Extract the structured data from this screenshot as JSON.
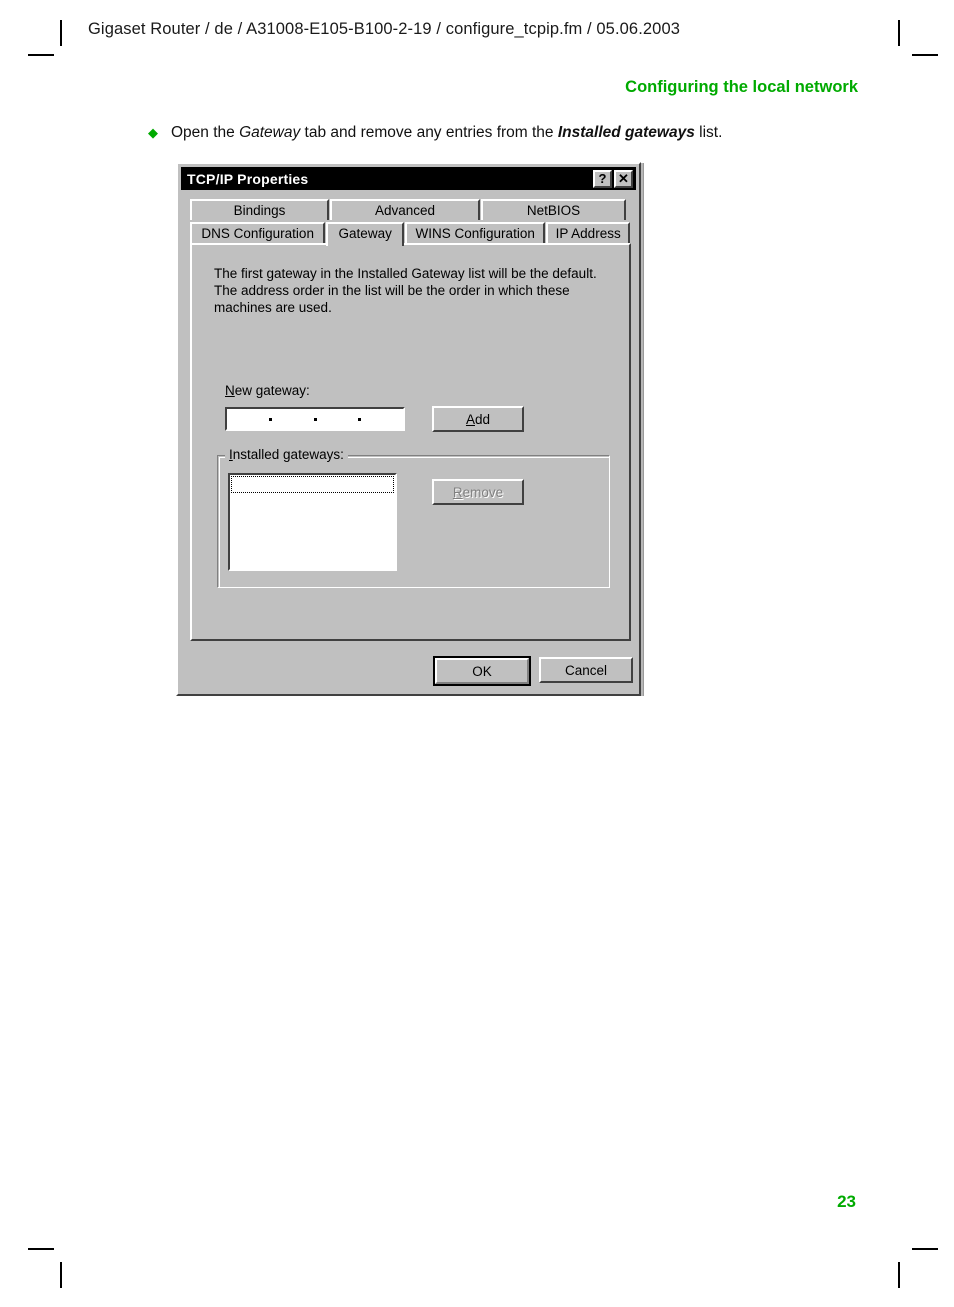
{
  "page": {
    "header": "Gigaset Router / de / A31008-E105-B100-2-19 / configure_tcpip.fm / 05.06.2003",
    "section_title": "Configuring the local network",
    "page_number": "23",
    "accent_color": "#00aa00"
  },
  "instruction": {
    "bullet": "◆",
    "part1": "Open the ",
    "emphasis1": "Gateway",
    "part2": " tab and remove any entries from the ",
    "emphasis2": "Installed gateways",
    "part3": " list."
  },
  "dialog": {
    "title": "TCP/IP Properties",
    "titlebar_buttons": [
      {
        "name": "help-button",
        "glyph": "?"
      },
      {
        "name": "close-button",
        "glyph": "✕"
      }
    ],
    "tabs_row_top": [
      {
        "label": "Bindings",
        "active": false
      },
      {
        "label": "Advanced",
        "active": false
      },
      {
        "label": "NetBIOS",
        "active": false
      }
    ],
    "tabs_row_bottom": [
      {
        "label": "DNS Configuration",
        "active": false
      },
      {
        "label": "Gateway",
        "active": true
      },
      {
        "label": "WINS Configuration",
        "active": false
      },
      {
        "label": "IP Address",
        "active": false
      }
    ],
    "description": "The first gateway in the Installed Gateway list will be the default. The address order in the list will be the order in which these machines are used.",
    "new_gateway": {
      "label_underlined": "N",
      "label_rest": "ew gateway:",
      "value": "",
      "octets": [
        "",
        "",
        "",
        ""
      ]
    },
    "add_button": {
      "underlined": "A",
      "rest": "dd",
      "enabled": true
    },
    "installed_gateways": {
      "label_underlined": "I",
      "label_rest": "nstalled gateways:",
      "items": [],
      "focused_row_empty": true
    },
    "remove_button": {
      "underlined": "R",
      "rest": "emove",
      "enabled": false
    },
    "ok_button": {
      "label": "OK",
      "default": true
    },
    "cancel_button": {
      "label": "Cancel",
      "default": false
    }
  }
}
